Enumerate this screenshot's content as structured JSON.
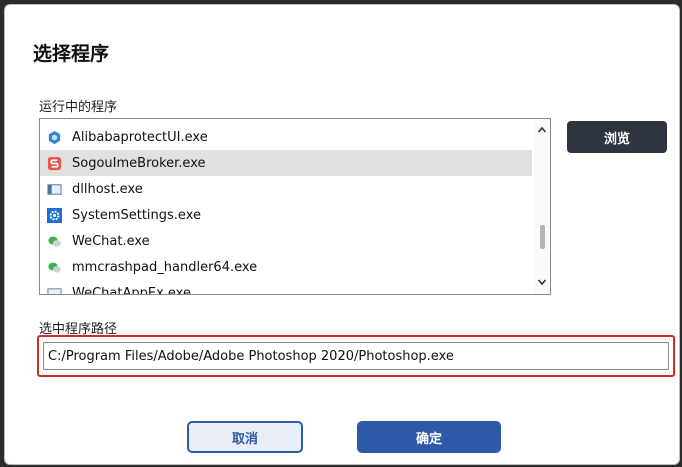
{
  "dialog": {
    "title": "选择程序",
    "running_label": "运行中的程序",
    "path_label": "选中程序路径"
  },
  "process_list": {
    "items": [
      {
        "name": "AlibabaprotectUI.exe",
        "icon": "alibaba-protect-icon",
        "selected": false
      },
      {
        "name": "SogouImeBroker.exe",
        "icon": "sogou-icon",
        "selected": true
      },
      {
        "name": "dllhost.exe",
        "icon": "dllhost-window-icon",
        "selected": false
      },
      {
        "name": "SystemSettings.exe",
        "icon": "settings-gear-icon",
        "selected": false
      },
      {
        "name": "WeChat.exe",
        "icon": "wechat-icon",
        "selected": false
      },
      {
        "name": "mmcrashpad_handler64.exe",
        "icon": "wechat-icon",
        "selected": false
      },
      {
        "name": "WeChatAppEx.exe",
        "icon": "window-icon",
        "selected": false
      }
    ]
  },
  "buttons": {
    "browse": "浏览",
    "cancel": "取消",
    "ok": "确定"
  },
  "path_input": {
    "value": "C:/Program Files/Adobe/Adobe Photoshop 2020/Photoshop.exe"
  },
  "colors": {
    "primary": "#2c5aa8",
    "dark_button": "#2e3440",
    "highlight_border": "#d52a21",
    "selected_row": "#e0e0e0"
  }
}
